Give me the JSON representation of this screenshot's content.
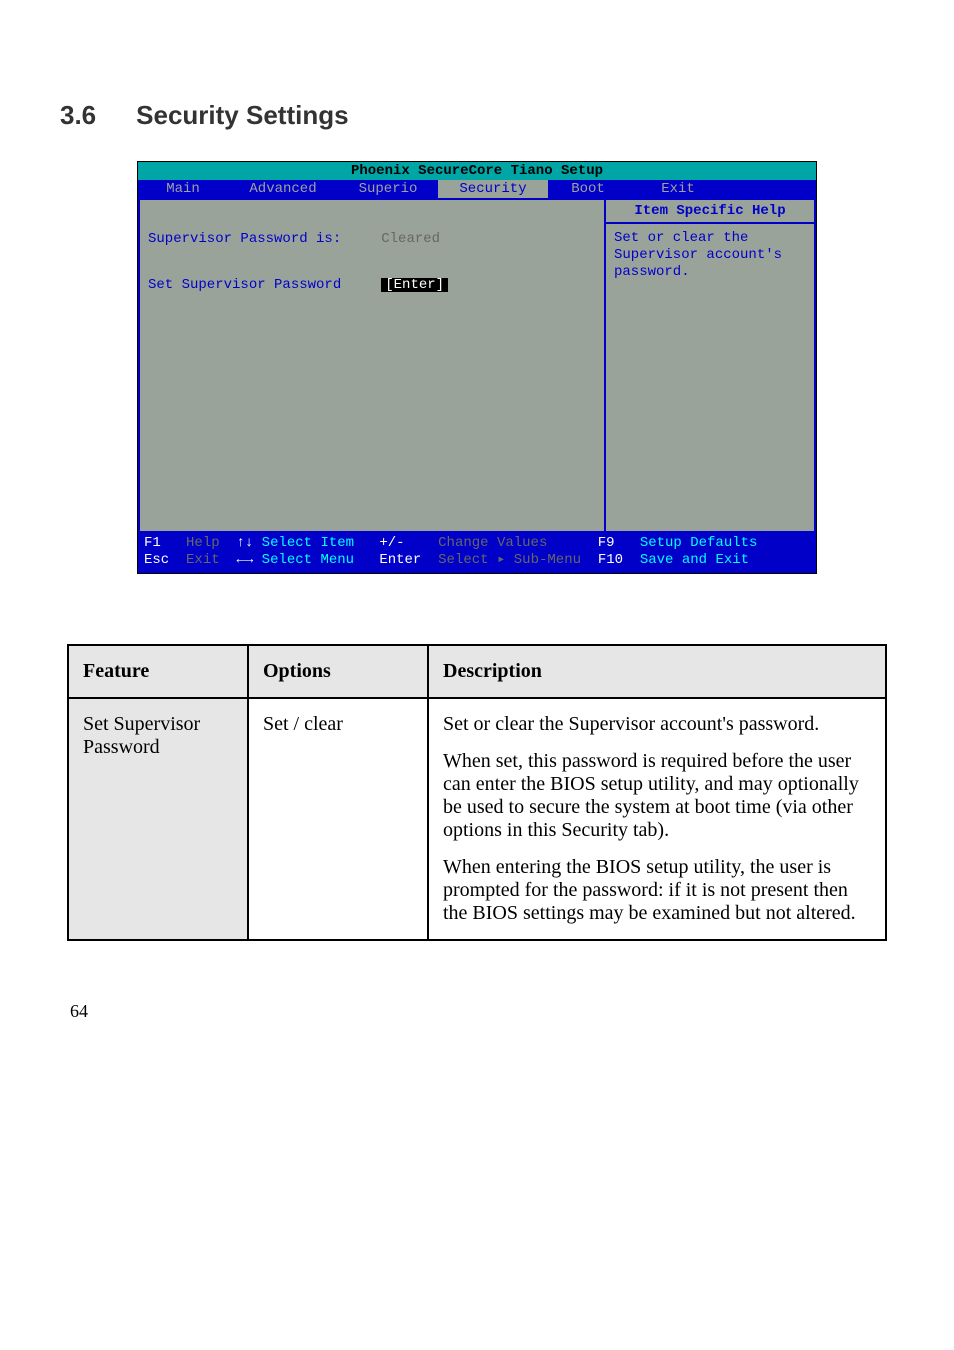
{
  "heading": {
    "number": "3.6",
    "title": "Security Settings"
  },
  "bios": {
    "title": "Phoenix SecureCore Tiano Setup",
    "menu": [
      "Main",
      "Advanced",
      "Superio",
      "Security",
      "Boot",
      "Exit"
    ],
    "left": {
      "row1_label": "Supervisor Password is:",
      "row1_value": "Cleared",
      "row2_label": "Set Supervisor Password",
      "row2_value": "[Enter]"
    },
    "help": {
      "title": "Item Specific Help",
      "body": "Set or clear the Supervisor account's password."
    },
    "footer": {
      "r1c1_key": "F1",
      "r1c1_lbl": "Help",
      "r1c2_key": "↑↓",
      "r1c2_lbl": "Select Item",
      "r1c3_key": "+/-",
      "r1c3_lbl": "Change Values",
      "r1c4_key": "F9",
      "r1c4_lbl": "Setup Defaults",
      "r2c1_key": "Esc",
      "r2c1_lbl": "Exit",
      "r2c2_key": "←→",
      "r2c2_lbl": "Select Menu",
      "r2c3_key": "Enter",
      "r2c3_lbl": "Select ▸ Sub-Menu",
      "r2c4_key": "F10",
      "r2c4_lbl": "Save and Exit"
    }
  },
  "table": {
    "headers": [
      "Feature",
      "Options",
      "Description"
    ],
    "row": {
      "feature": "Set Supervisor Password",
      "options": "Set / clear",
      "p1": "Set or clear the Supervisor account's password.",
      "p2": "When set, this password is required before the user can enter the BIOS setup utility, and may optionally be used to secure the system at boot time (via other options in this Security tab).",
      "p3": "When entering the BIOS setup utility, the user is prompted for the password: if it is not present then the BIOS settings may be examined but not altered."
    }
  },
  "footer_page": "64"
}
